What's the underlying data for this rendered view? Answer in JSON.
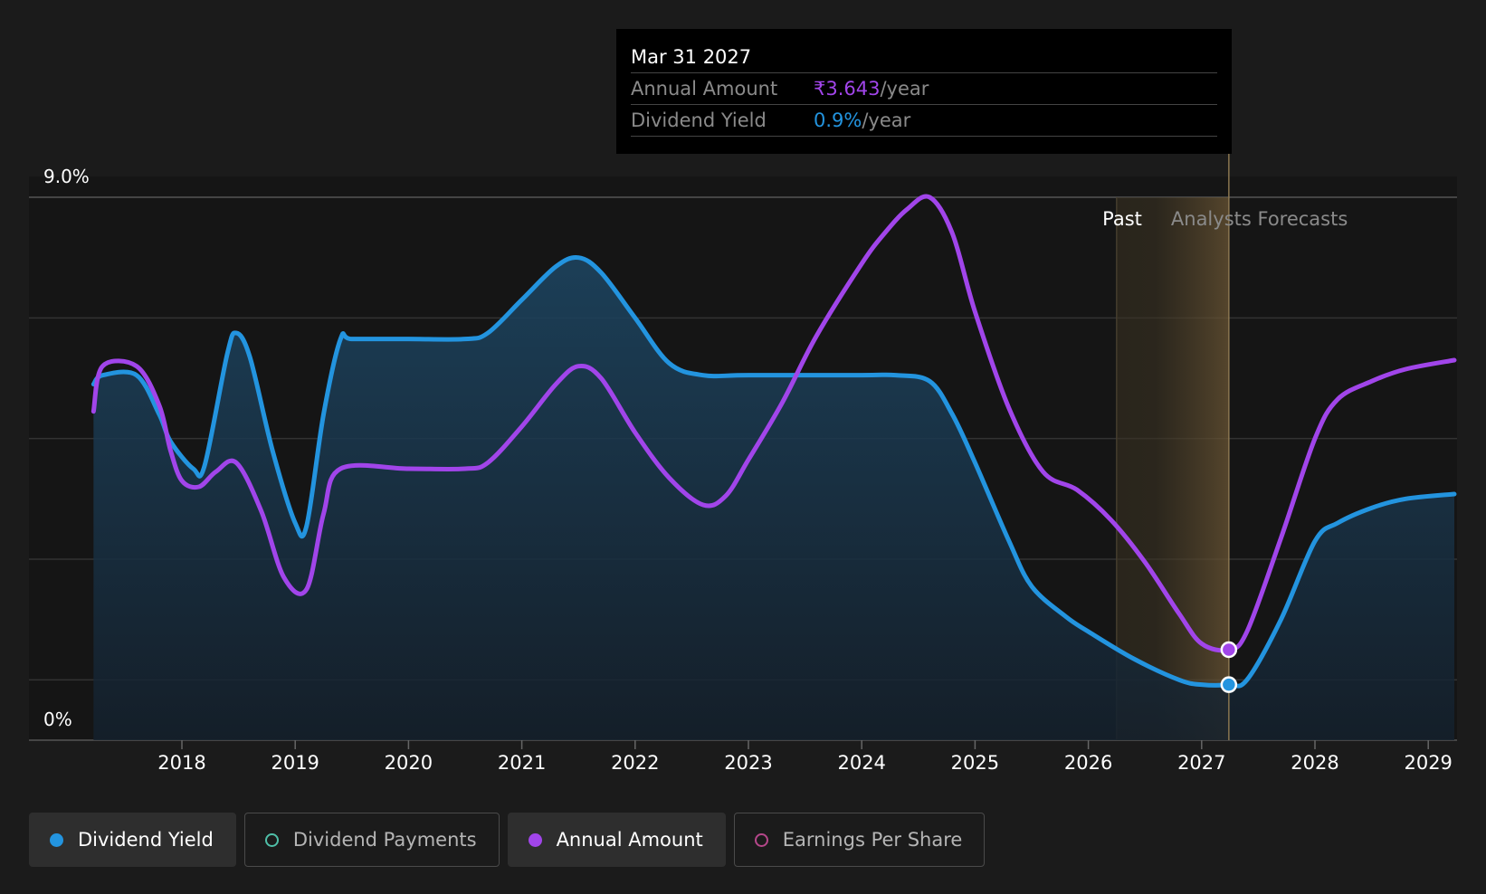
{
  "chart_data": {
    "type": "area",
    "y_axis": {
      "top_label": "9.0%",
      "bottom_label": "0%",
      "ylim": [
        0,
        9.0
      ]
    },
    "x_ticks": [
      "2018",
      "2019",
      "2020",
      "2021",
      "2022",
      "2023",
      "2024",
      "2025",
      "2026",
      "2027",
      "2028",
      "2029"
    ],
    "period_labels": {
      "past": "Past",
      "forecast": "Analysts Forecasts"
    },
    "series": [
      {
        "name": "Dividend Yield",
        "color": "#2394df",
        "filled": true,
        "points": [
          [
            2017.22,
            5.9
          ],
          [
            2017.3,
            6.05
          ],
          [
            2017.6,
            6.05
          ],
          [
            2017.8,
            5.4
          ],
          [
            2017.9,
            4.95
          ],
          [
            2018.1,
            4.5
          ],
          [
            2018.2,
            4.55
          ],
          [
            2018.4,
            6.4
          ],
          [
            2018.48,
            6.75
          ],
          [
            2018.6,
            6.35
          ],
          [
            2018.8,
            4.8
          ],
          [
            2019.0,
            3.6
          ],
          [
            2019.1,
            3.55
          ],
          [
            2019.25,
            5.4
          ],
          [
            2019.4,
            6.65
          ],
          [
            2019.5,
            6.65
          ],
          [
            2020.0,
            6.65
          ],
          [
            2020.5,
            6.65
          ],
          [
            2020.7,
            6.75
          ],
          [
            2021.0,
            7.3
          ],
          [
            2021.3,
            7.85
          ],
          [
            2021.5,
            8.0
          ],
          [
            2021.7,
            7.75
          ],
          [
            2022.0,
            7.0
          ],
          [
            2022.3,
            6.25
          ],
          [
            2022.6,
            6.05
          ],
          [
            2023.0,
            6.05
          ],
          [
            2024.0,
            6.05
          ],
          [
            2024.3,
            6.05
          ],
          [
            2024.6,
            5.95
          ],
          [
            2024.8,
            5.4
          ],
          [
            2025.0,
            4.6
          ],
          [
            2025.3,
            3.3
          ],
          [
            2025.5,
            2.55
          ],
          [
            2025.8,
            2.05
          ],
          [
            2026.0,
            1.8
          ],
          [
            2026.4,
            1.35
          ],
          [
            2026.8,
            1.0
          ],
          [
            2027.0,
            0.92
          ],
          [
            2027.24,
            0.92
          ],
          [
            2027.4,
            1.0
          ],
          [
            2027.7,
            2.0
          ],
          [
            2028.0,
            3.3
          ],
          [
            2028.2,
            3.6
          ],
          [
            2028.5,
            3.85
          ],
          [
            2028.8,
            4.0
          ],
          [
            2029.23,
            4.08
          ]
        ]
      },
      {
        "name": "Annual Amount",
        "color": "#a145ea",
        "filled": false,
        "points": [
          [
            2017.22,
            5.45
          ],
          [
            2017.3,
            6.2
          ],
          [
            2017.6,
            6.2
          ],
          [
            2017.8,
            5.55
          ],
          [
            2017.9,
            4.8
          ],
          [
            2018.0,
            4.3
          ],
          [
            2018.15,
            4.2
          ],
          [
            2018.3,
            4.45
          ],
          [
            2018.48,
            4.6
          ],
          [
            2018.7,
            3.8
          ],
          [
            2018.9,
            2.7
          ],
          [
            2019.1,
            2.5
          ],
          [
            2019.25,
            3.75
          ],
          [
            2019.4,
            4.5
          ],
          [
            2020.0,
            4.5
          ],
          [
            2020.5,
            4.5
          ],
          [
            2020.7,
            4.6
          ],
          [
            2021.0,
            5.2
          ],
          [
            2021.3,
            5.9
          ],
          [
            2021.5,
            6.2
          ],
          [
            2021.7,
            6.0
          ],
          [
            2022.0,
            5.1
          ],
          [
            2022.3,
            4.35
          ],
          [
            2022.6,
            3.9
          ],
          [
            2022.8,
            4.05
          ],
          [
            2023.0,
            4.65
          ],
          [
            2023.3,
            5.6
          ],
          [
            2023.6,
            6.7
          ],
          [
            2024.0,
            7.9
          ],
          [
            2024.2,
            8.4
          ],
          [
            2024.4,
            8.8
          ],
          [
            2024.6,
            9.0
          ],
          [
            2024.8,
            8.4
          ],
          [
            2025.0,
            7.1
          ],
          [
            2025.3,
            5.5
          ],
          [
            2025.6,
            4.45
          ],
          [
            2025.9,
            4.15
          ],
          [
            2026.2,
            3.65
          ],
          [
            2026.5,
            2.95
          ],
          [
            2026.8,
            2.1
          ],
          [
            2027.0,
            1.6
          ],
          [
            2027.24,
            1.5
          ],
          [
            2027.4,
            1.8
          ],
          [
            2027.7,
            3.35
          ],
          [
            2028.0,
            5.0
          ],
          [
            2028.2,
            5.65
          ],
          [
            2028.5,
            5.95
          ],
          [
            2028.8,
            6.15
          ],
          [
            2029.23,
            6.3
          ]
        ]
      }
    ],
    "forecast_region": {
      "past_end": 2026.25,
      "marker_date": 2027.24
    },
    "x_range": [
      2017.22,
      2029.23
    ],
    "markers": [
      {
        "series": "Annual Amount",
        "x": 2027.24,
        "y": 1.5
      },
      {
        "series": "Dividend Yield",
        "x": 2027.24,
        "y": 0.92
      }
    ]
  },
  "tooltip": {
    "date": "Mar 31 2027",
    "rows": [
      {
        "label": "Annual Amount",
        "value": "₹3.643",
        "unit": "/year",
        "color": "#a145ea"
      },
      {
        "label": "Dividend Yield",
        "value": "0.9%",
        "unit": "/year",
        "color": "#2394df"
      }
    ]
  },
  "legend": [
    {
      "label": "Dividend Yield",
      "active": true,
      "dot": "#2394df",
      "hollow": false
    },
    {
      "label": "Dividend Payments",
      "active": false,
      "dot": "#4fbfa8",
      "hollow": true
    },
    {
      "label": "Annual Amount",
      "active": true,
      "dot": "#a145ea",
      "hollow": false
    },
    {
      "label": "Earnings Per Share",
      "active": false,
      "dot": "#b5478a",
      "hollow": true
    }
  ]
}
